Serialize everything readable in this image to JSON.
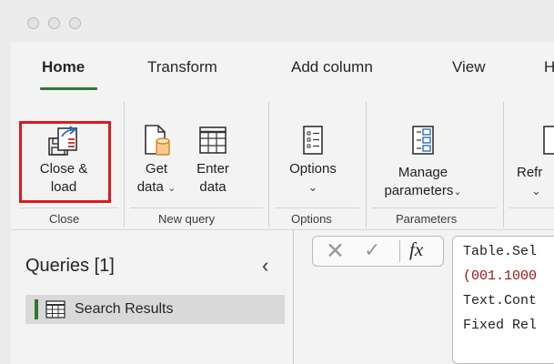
{
  "tabs": [
    {
      "label": "Home"
    },
    {
      "label": "Transform"
    },
    {
      "label": "Add column"
    },
    {
      "label": "View"
    },
    {
      "label": "H"
    }
  ],
  "ribbon": {
    "close_load": {
      "line1": "Close &",
      "line2": "load"
    },
    "get_data": {
      "line1": "Get",
      "line2": "data"
    },
    "enter_data": {
      "line1": "Enter",
      "line2": "data"
    },
    "options": {
      "line1": "Options"
    },
    "manage_parameters": {
      "line1": "Manage",
      "line2": "parameters"
    },
    "refresh": {
      "line1": "Refr"
    },
    "groups": {
      "close": "Close",
      "new_query": "New query",
      "options": "Options",
      "parameters": "Parameters"
    }
  },
  "queries": {
    "title": "Queries [1]",
    "items": [
      {
        "label": "Search Results"
      }
    ]
  },
  "formula": {
    "fx_label": "fx",
    "lines": [
      "Table.Sel",
      "(001.1000",
      "Text.Cont",
      "Fixed Rel"
    ]
  },
  "colors": {
    "accent": "#2b7a2b",
    "highlight": "#e0191b",
    "formula_red": "#a31515"
  }
}
